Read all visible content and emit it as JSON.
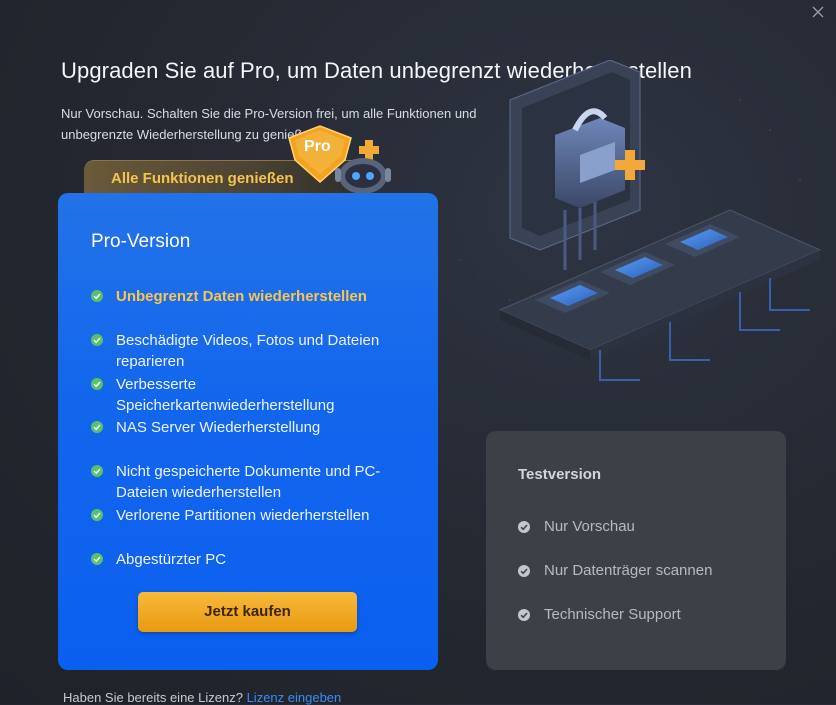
{
  "header": {
    "title": "Upgraden Sie auf Pro, um Daten unbegrenzt  wiederherzustellen",
    "subtitle": "Nur Vorschau. Schalten Sie die Pro-Version frei, um alle Funktionen und unbegrenzte Wiederherstellung zu genießen."
  },
  "close_icon": "close-icon",
  "tab": {
    "label": "Alle Funktionen genießen"
  },
  "badge": {
    "label": "Pro"
  },
  "pro": {
    "title": "Pro-Version",
    "features": [
      "Unbegrenzt Daten wiederherstellen",
      "Beschädigte Videos, Fotos und Dateien reparieren",
      "Verbesserte Speicherkartenwiederherstellung",
      "NAS Server Wiederherstellung",
      "Nicht gespeicherte Dokumente und PC-Dateien wiederherstellen",
      "Verlorene Partitionen wiederherstellen",
      "Abgestürzter PC"
    ],
    "buy_label": "Jetzt kaufen"
  },
  "trial": {
    "title": "Testversion",
    "features": [
      "Nur Vorschau",
      "Nur Datenträger scannen",
      "Technischer Support"
    ]
  },
  "footer": {
    "question": "Haben Sie bereits eine Lizenz?",
    "link": "Lizenz eingeben"
  },
  "colors": {
    "accent_blue": "#1266ec",
    "gold": "#f8c54e",
    "check_green": "#57c26b"
  }
}
